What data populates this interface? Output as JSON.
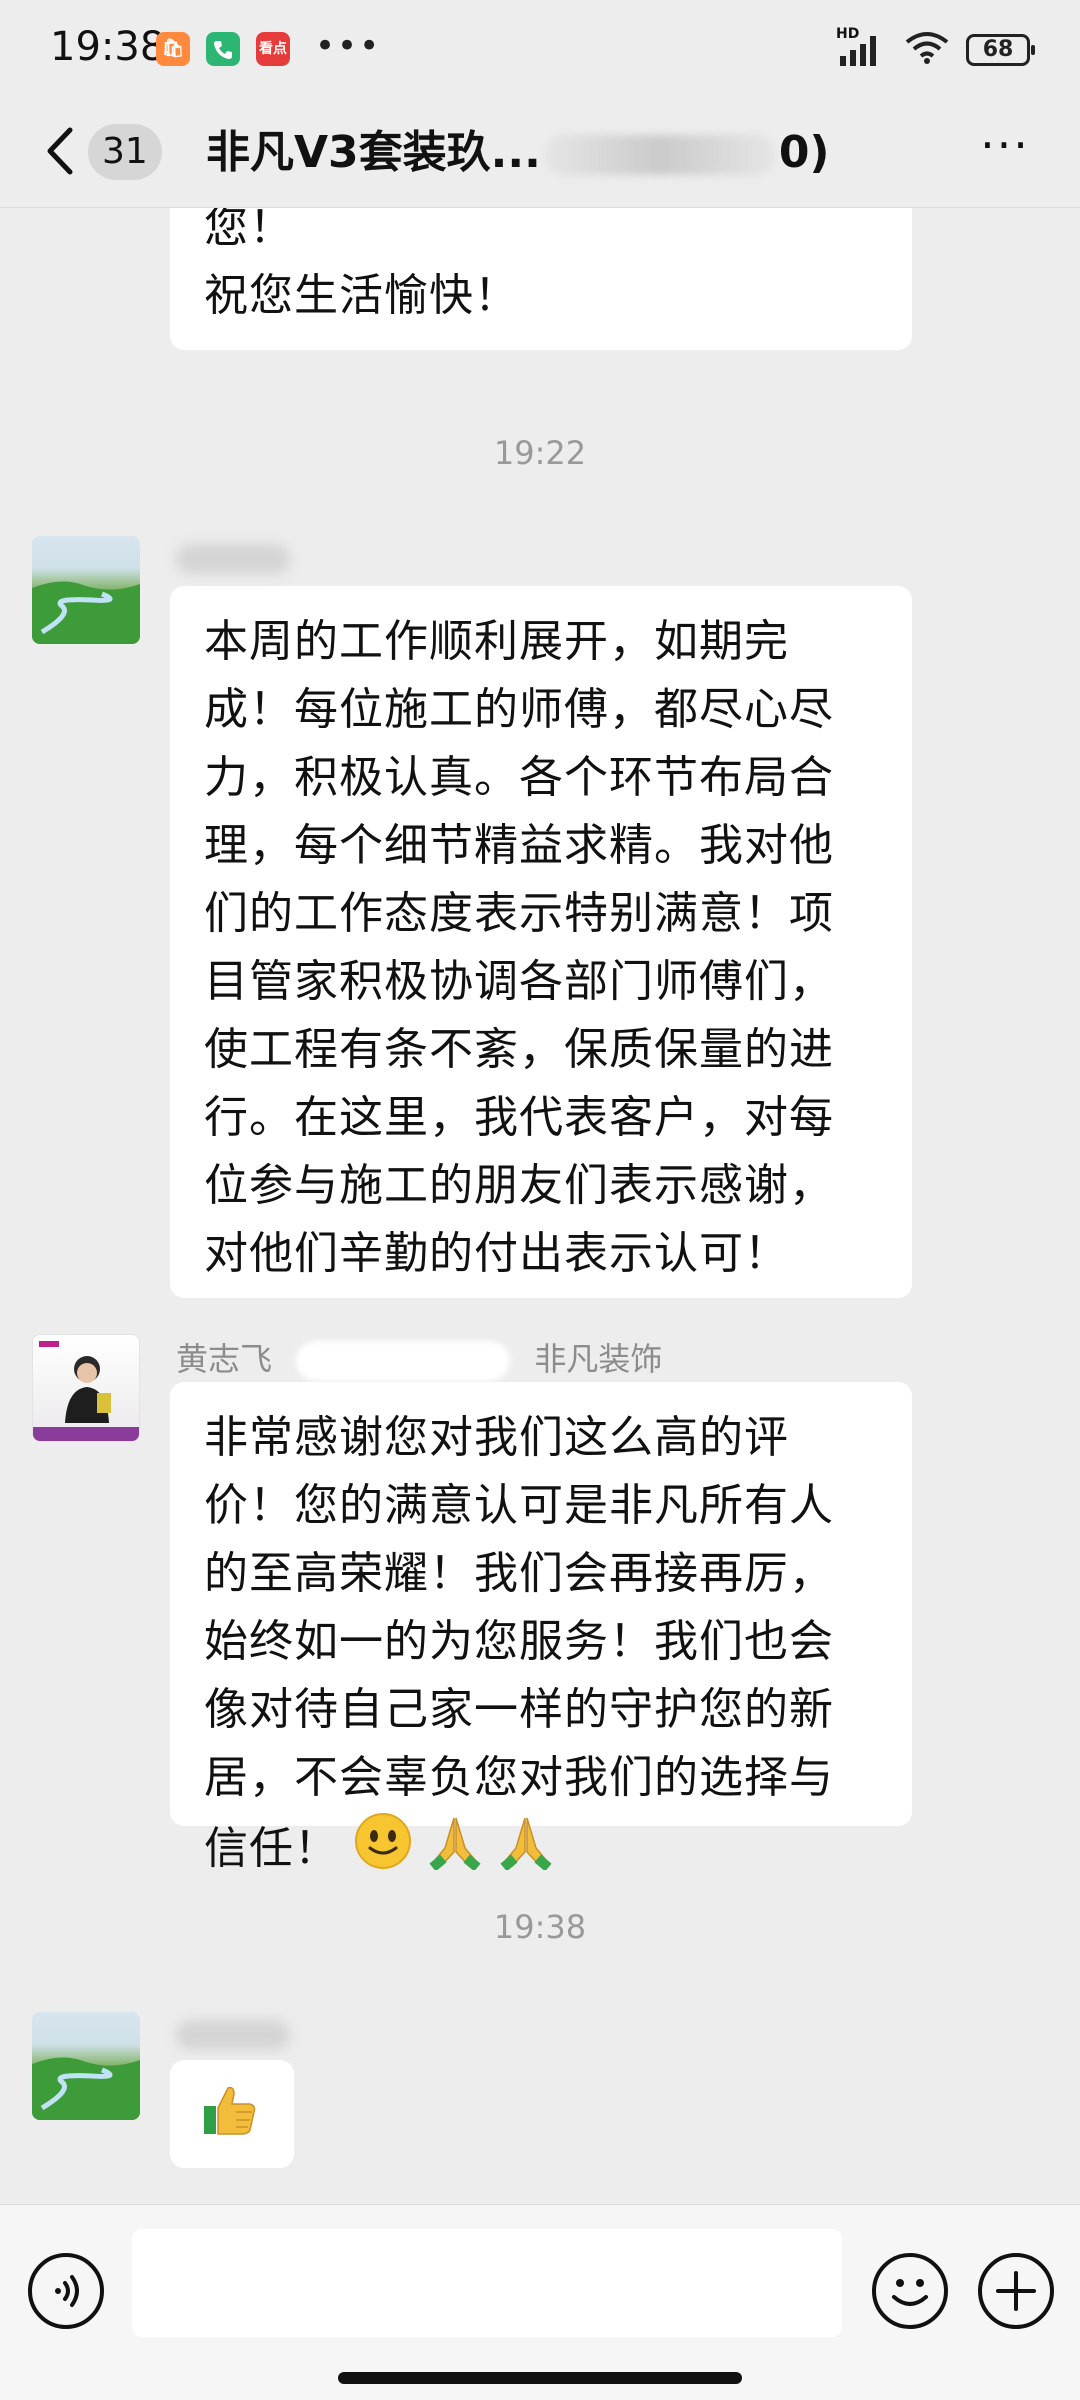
{
  "status_bar": {
    "time": "19:38",
    "app_icon_label": "看点",
    "overflow": "•••",
    "network": "HD",
    "battery": "68"
  },
  "header": {
    "back_icon": "chevron-left-icon",
    "unread_count": "31",
    "title_prefix": "非凡V3套装玖...",
    "title_suffix": "0)",
    "more_icon": "more-dots-icon",
    "more_label": "···"
  },
  "messages": {
    "m0": {
      "text": "您！\n祝您生活愉快！"
    },
    "time1": "19:22",
    "m1": {
      "text": "本周的工作顺利展开，如期完成！每位施工的师傅，都尽心尽力，积极认真。各个环节布局合理，每个细节精益求精。我对他们的工作态度表示特别满意！项目管家积极协调各部门师傅们，使工程有条不紊，保质保量的进行。在这里，我代表客户，对每位参与施工的朋友们表示感谢，对他们辛勤的付出表示认可！"
    },
    "m2": {
      "sender_name": "黄志飞",
      "sender_company": "非凡装饰",
      "text": "非常感谢您对我们这么高的评价！您的满意认可是非凡所有人的至高荣耀！我们会再接再厉，始终如一的为您服务！我们也会像对待自己家一样的守护您的新居，不会辜负您对我们的选择与信任！",
      "emoji": [
        "slightly-smiling-face",
        "folded-hands",
        "folded-hands"
      ]
    },
    "time2": "19:38",
    "m3": {
      "emoji": "thumbs-up"
    }
  },
  "input_bar": {
    "voice_icon": "voice-icon",
    "emoji_icon": "smiley-icon",
    "plus_icon": "plus-icon"
  },
  "colors": {
    "background": "#ededed",
    "bubble": "#ffffff",
    "timestamp": "#999999",
    "sender_name": "#8c8c8c"
  }
}
